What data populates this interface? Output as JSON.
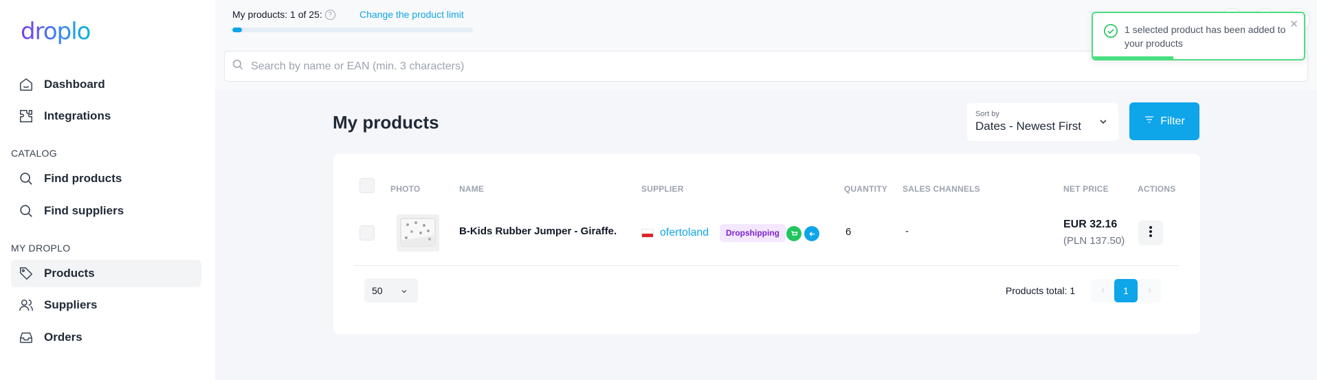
{
  "brand": {
    "logo_text": "droplo"
  },
  "sidebar": {
    "items_top": [
      {
        "label": "Dashboard",
        "icon": "home-icon"
      },
      {
        "label": "Integrations",
        "icon": "puzzle-icon"
      }
    ],
    "catalog_label": "CATALOG",
    "catalog_items": [
      {
        "label": "Find products",
        "icon": "search-icon"
      },
      {
        "label": "Find suppliers",
        "icon": "search-icon"
      }
    ],
    "my_droplo_label": "MY DROPLO",
    "my_droplo_items": [
      {
        "label": "Products",
        "icon": "tag-icon",
        "active": true
      },
      {
        "label": "Suppliers",
        "icon": "users-icon"
      },
      {
        "label": "Orders",
        "icon": "inbox-icon"
      }
    ]
  },
  "topbar": {
    "limit_text": "My products: 1 of 25:",
    "limit_help": "?",
    "limit_link": "Change the product limit",
    "limit_progress_fraction": 0.04,
    "search_placeholder": "Search by name or EAN (min. 3 characters)"
  },
  "main": {
    "title": "My products",
    "sort": {
      "caption": "Sort by",
      "value": "Dates - Newest First"
    },
    "filter_label": "Filter",
    "columns": {
      "photo": "PHOTO",
      "name": "NAME",
      "supplier": "SUPPLIER",
      "quantity": "QUANTITY",
      "sales_channels": "SALES CHANNELS",
      "net_price": "NET PRICE",
      "actions": "ACTIONS"
    },
    "rows": [
      {
        "name": "B-Kids Rubber Jumper - Giraffe.",
        "supplier": "ofertoland",
        "supplier_country_flag": "poland-flag",
        "tag": "Dropshipping",
        "quantity": "6",
        "sales_channels": "-",
        "price": "EUR 32.16",
        "price_pln": "(PLN 137.50)"
      }
    ],
    "per_page": "50",
    "total_text": "Products total: 1",
    "current_page": "1"
  },
  "toast": {
    "message": "1 selected product has been added to your products",
    "close": "✕",
    "progress_fraction": 0.38
  },
  "colors": {
    "accent": "#0ea5e9",
    "success": "#4ade80",
    "tag_bg": "#f3e8ff",
    "tag_text": "#7e22ce"
  }
}
